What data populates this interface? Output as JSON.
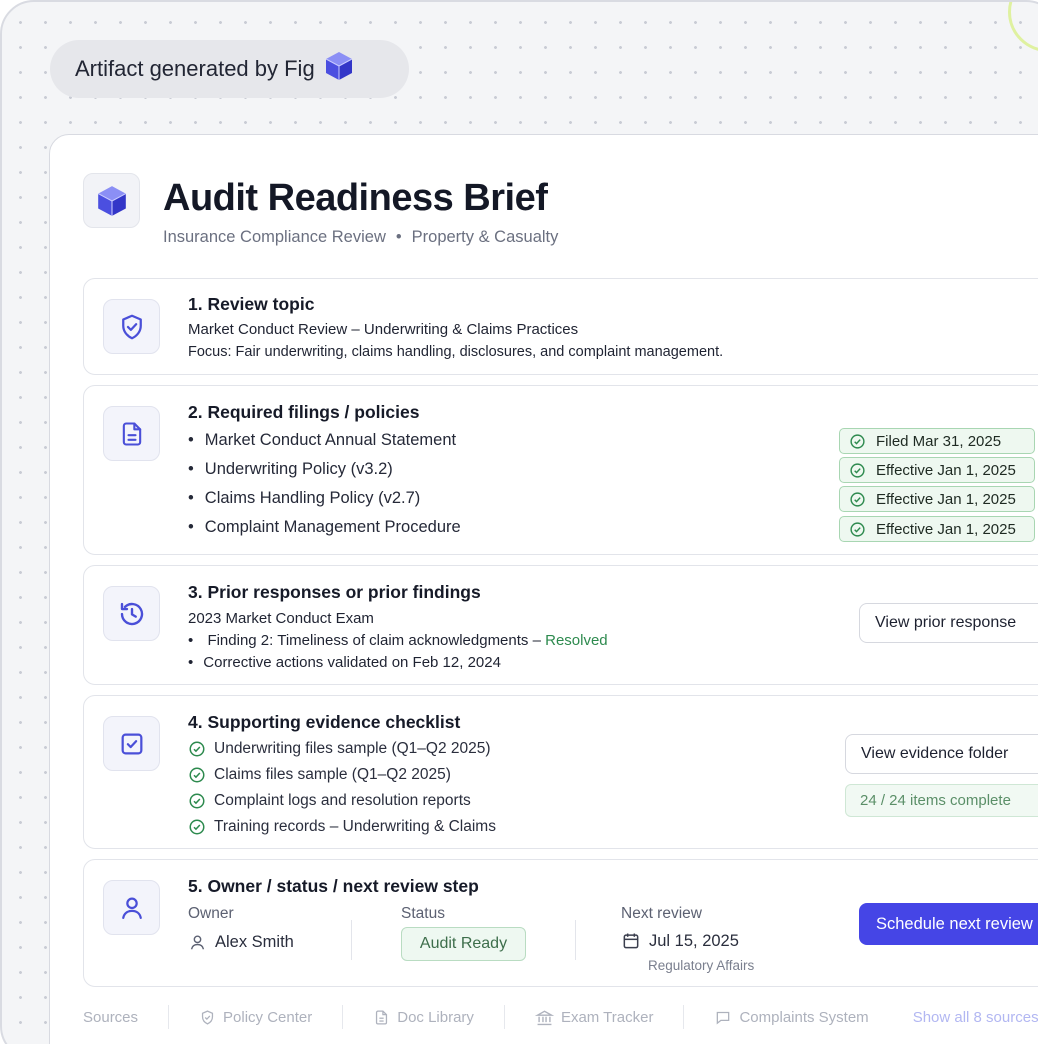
{
  "badge": {
    "label": "Artifact generated by Fig"
  },
  "header": {
    "title": "Audit Readiness Brief",
    "subtitle_left": "Insurance Compliance Review",
    "subtitle_sep": "•",
    "subtitle_right": "Property & Casualty"
  },
  "sections": {
    "topic": {
      "title": "1.  Review topic",
      "line1": "Market Conduct Review – Underwriting & Claims Practices",
      "line2": "Focus: Fair underwriting, claims handling, disclosures, and complaint management."
    },
    "filings": {
      "title": "2.  Required filings / policies",
      "items": [
        {
          "name": "Market Conduct Annual Statement",
          "status": "Filed Mar 31, 2025"
        },
        {
          "name": "Underwriting Policy (v3.2)",
          "status": "Effective Jan 1, 2025"
        },
        {
          "name": "Claims Handling Policy (v2.7)",
          "status": "Effective Jan 1, 2025"
        },
        {
          "name": "Complaint Management Procedure",
          "status": "Effective Jan 1, 2025"
        }
      ]
    },
    "prior": {
      "title": "3.  Prior responses or prior findings",
      "exam": "2023 Market Conduct Exam",
      "finding": "Finding 2: Timeliness of claim acknowledgments –",
      "finding_status": "Resolved",
      "corrective": "Corrective actions validated on Feb 12, 2024",
      "button": "View prior response"
    },
    "evidence": {
      "title": "4.  Supporting evidence checklist",
      "items": [
        "Underwriting files sample (Q1–Q2 2025)",
        "Claims files sample (Q1–Q2 2025)",
        "Complaint logs and resolution reports",
        "Training records – Underwriting & Claims"
      ],
      "button": "View evidence folder",
      "progress": "24 / 24 items complete"
    },
    "owner": {
      "title": "5.  Owner / status / next review step",
      "owner_label": "Owner",
      "owner_value": "Alex Smith",
      "status_label": "Status",
      "status_value": "Audit Ready",
      "next_label": "Next review",
      "next_value": "Jul 15, 2025",
      "next_team": "Regulatory Affairs",
      "button": "Schedule next review"
    }
  },
  "sources": {
    "label": "Sources",
    "items": [
      "Policy Center",
      "Doc Library",
      "Exam Tracker",
      "Complaints System"
    ],
    "show_all": "Show all 8 sources"
  },
  "colors": {
    "accent": "#4545e6",
    "success": "#2d8a4e",
    "icon": "#4a4fd8"
  }
}
